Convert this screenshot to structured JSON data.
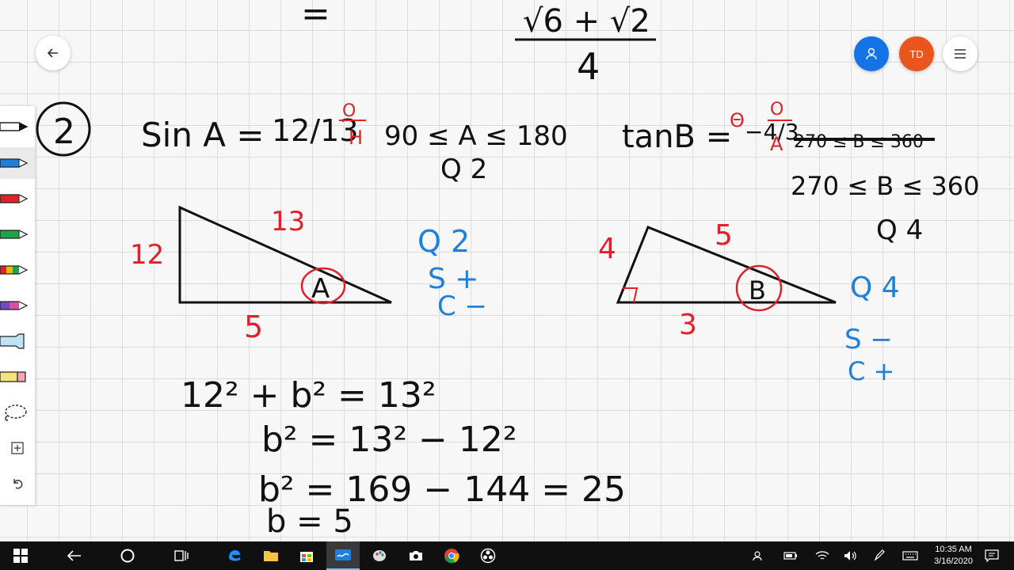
{
  "whiteboard": {
    "top": {
      "eq": "=",
      "numerator": "√6 + √2",
      "denominator": "4"
    },
    "problem_number": "2",
    "left": {
      "given": "Sin A =",
      "given_fraction": "12/13",
      "o_label": "O",
      "h_label": "H",
      "range": "90 ≤ A ≤ 180",
      "quadrant": "Q 2",
      "triangle": {
        "opp": "12",
        "hyp": "13",
        "adj": "5",
        "angle": "A"
      },
      "signs": {
        "q": "Q 2",
        "s": "S +",
        "c": "C −"
      },
      "work": [
        "12² + b² = 13²",
        "b² = 13² − 12²",
        "b² = 169 − 144 = 25",
        "b = 5"
      ]
    },
    "right": {
      "given": "tanB =",
      "given_fraction": "−4/3",
      "crossed": "Θ",
      "o_label": "O",
      "a_label": "A",
      "scribble": "270 ≤ B ≤ 360",
      "range": "270 ≤ B ≤ 360",
      "quadrant": "Q 4",
      "triangle": {
        "opp": "4",
        "hyp": "5",
        "adj": "3",
        "angle": "B"
      },
      "signs": {
        "q": "Q 4",
        "s": "S −",
        "c": "C +"
      }
    }
  },
  "user_initials": "TD",
  "clock": {
    "time": "10:35 AM",
    "date": "3/16/2020"
  }
}
